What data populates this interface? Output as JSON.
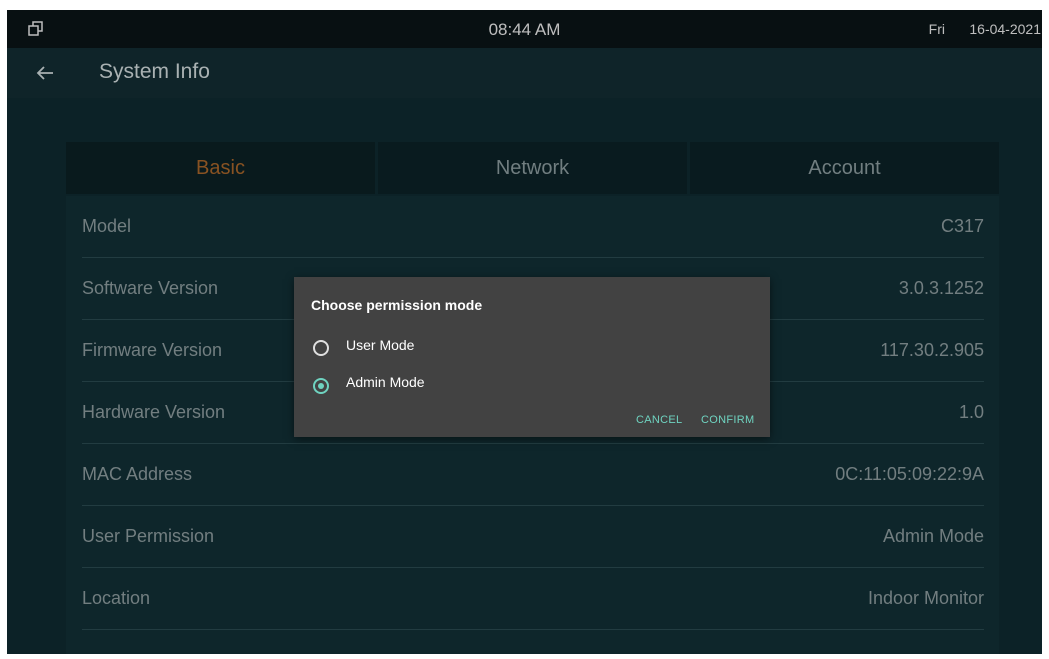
{
  "status_bar": {
    "time": "08:44 AM",
    "day": "Fri",
    "date": "16-04-2021",
    "left_icon": "window-restore-icon"
  },
  "header": {
    "back_icon": "arrow-left-icon",
    "title": "System Info"
  },
  "tabs": [
    {
      "label": "Basic",
      "active": true
    },
    {
      "label": "Network",
      "active": false
    },
    {
      "label": "Account",
      "active": false
    }
  ],
  "info_rows": [
    {
      "label": "Model",
      "value": "C317"
    },
    {
      "label": "Software Version",
      "value": "3.0.3.1252"
    },
    {
      "label": "Firmware Version",
      "value": "117.30.2.905"
    },
    {
      "label": "Hardware Version",
      "value": "1.0"
    },
    {
      "label": "MAC Address",
      "value": "0C:11:05:09:22:9A"
    },
    {
      "label": "User Permission",
      "value": "Admin Mode"
    },
    {
      "label": "Location",
      "value": "Indoor Monitor"
    }
  ],
  "dialog": {
    "title": "Choose permission mode",
    "options": [
      {
        "label": "User Mode",
        "selected": false
      },
      {
        "label": "Admin Mode",
        "selected": true
      }
    ],
    "cancel_label": "CANCEL",
    "confirm_label": "CONFIRM"
  },
  "colors": {
    "active_tab": "#a7652a",
    "accent": "#6fd3c0",
    "dialog_bg": "#424242"
  }
}
